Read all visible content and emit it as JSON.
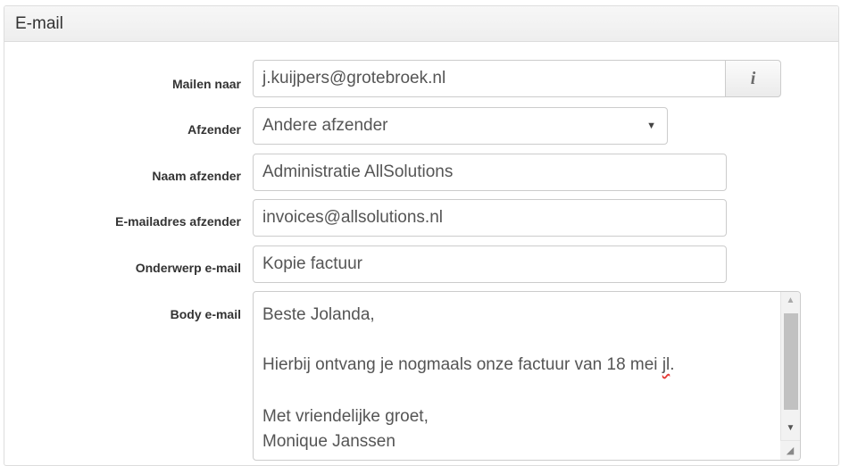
{
  "panel": {
    "title": "E-mail"
  },
  "fields": {
    "mailen_naar": {
      "label": "Mailen naar",
      "value": "j.kuijpers@grotebroek.nl",
      "info_icon": "i"
    },
    "afzender": {
      "label": "Afzender",
      "value": "Andere afzender",
      "caret": "▼"
    },
    "naam_afzender": {
      "label": "Naam afzender",
      "value": "Administratie AllSolutions"
    },
    "emailadres_afzender": {
      "label": "E-mailadres afzender",
      "value": "invoices@allsolutions.nl"
    },
    "onderwerp": {
      "label": "Onderwerp e-mail",
      "value": "Kopie factuur"
    },
    "body": {
      "label": "Body e-mail",
      "line1": "Beste Jolanda,",
      "line2_pre": "Hierbij ontvang je nogmaals onze factuur van 18 mei ",
      "line2_spell": "jl",
      "line2_post": ".",
      "line3": "Met vriendelijke groet,",
      "line4": "Monique Janssen"
    }
  },
  "icons": {
    "scroll_up": "▲",
    "scroll_down": "▼",
    "resize": "◢"
  }
}
